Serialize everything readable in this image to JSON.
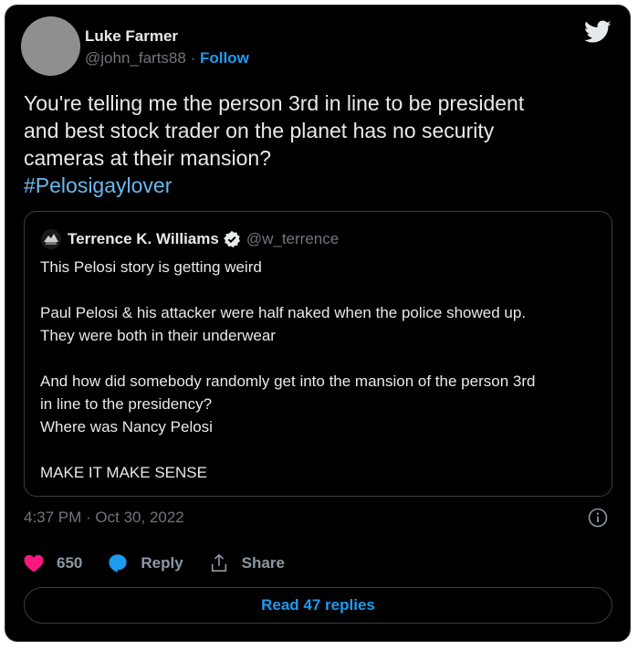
{
  "author": {
    "name": "Luke Farmer",
    "handle": "@john_farts88",
    "separator": "·",
    "follow_label": "Follow"
  },
  "tweet": {
    "text_lines": [
      "You're telling me the person 3rd in line to be president",
      "and best stock trader on the planet has no security",
      "cameras at their mansion?"
    ],
    "hashtag": "#Pelosigaylover"
  },
  "quoted": {
    "name": "Terrence K. Williams",
    "handle": "@w_terrence",
    "lines": [
      "This Pelosi story is getting weird",
      "Paul Pelosi & his attacker were half naked when the police showed up.",
      "They were both in their underwear",
      "And how did somebody randomly get into the mansion of the person 3rd",
      "in line to the presidency?",
      "Where was Nancy Pelosi",
      "MAKE IT MAKE SENSE"
    ]
  },
  "timestamp": "4:37 PM · Oct 30, 2022",
  "actions": {
    "like_count": "650",
    "reply_label": "Reply",
    "share_label": "Share"
  },
  "read_replies_label": "Read 47 replies",
  "colors": {
    "background": "#000000",
    "accent": "#1d9bf0",
    "hashtag": "#6ab8ee",
    "like": "#f91880",
    "muted": "#71767b"
  },
  "icons": [
    "twitter-bird-icon",
    "verified-badge-icon",
    "info-icon",
    "heart-icon",
    "reply-bubble-icon",
    "share-icon"
  ]
}
